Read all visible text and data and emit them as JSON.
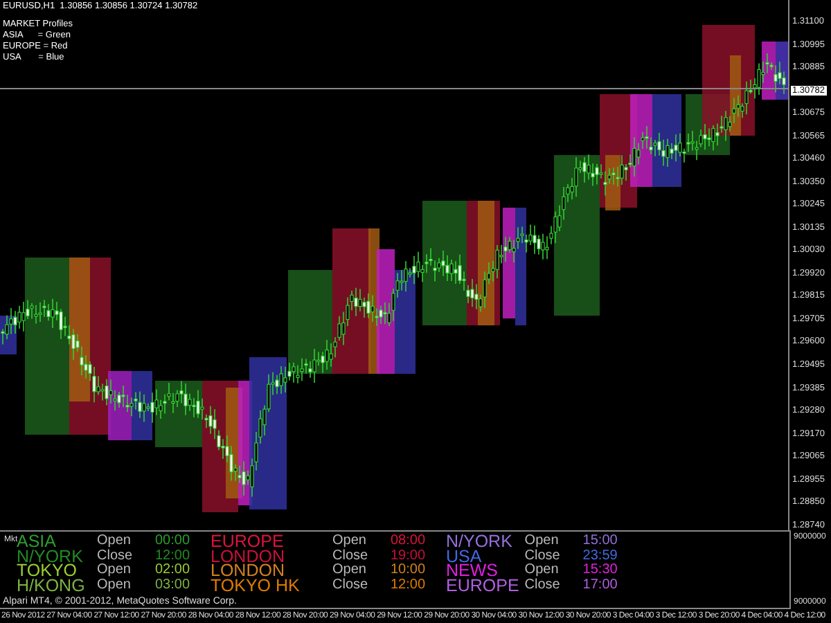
{
  "chart": {
    "title": "EURUSD,H1  1.30856 1.30856 1.30724 1.30782",
    "legend": [
      "MARKET Profiles",
      "ASIA      = Green",
      "EUROPE = Red",
      "USA       = Blue"
    ],
    "price_ticks": [
      {
        "label": "1.31100",
        "current": false
      },
      {
        "label": "1.30995",
        "current": false
      },
      {
        "label": "1.30885",
        "current": false
      },
      {
        "label": "1.30782",
        "current": true
      },
      {
        "label": "1.30675",
        "current": false
      }
    ],
    "price_ticks_lower": [
      "1.30565",
      "1.30460",
      "1.30350",
      "1.30245",
      "1.30135",
      "1.30030",
      "1.29920",
      "1.29815",
      "1.29705",
      "1.29600",
      "1.29495",
      "1.29385",
      "1.29280",
      "1.29170",
      "1.29065",
      "1.28955",
      "1.28850",
      "1.28740"
    ]
  },
  "indicator": {
    "label": "Mkt",
    "axis": [
      "9000000",
      "9000000"
    ],
    "sessions": [
      {
        "rows": [
          {
            "name": "ASIA",
            "status": "Open",
            "time": "00:00",
            "color": "#2e9e2e"
          },
          {
            "name": "N/YORK",
            "status": "Close",
            "time": "12:00",
            "color": "#228b22"
          },
          {
            "name": "TOKYO",
            "status": "Open",
            "time": "02:00",
            "color": "#9acd32"
          },
          {
            "name": "H/KONG",
            "status": "Open",
            "time": "03:00",
            "color": "#7cb342"
          }
        ]
      },
      {
        "rows": [
          {
            "name": "EUROPE",
            "status": "Open",
            "time": "08:00",
            "color": "#dc143c"
          },
          {
            "name": "LONDON",
            "status": "Close",
            "time": "19:00",
            "color": "#c8103a"
          },
          {
            "name": "LONDON",
            "status": "Open",
            "time": "10:00",
            "color": "#d2821e"
          },
          {
            "name": "TOKYO HK",
            "status": "Close",
            "time": "12:00",
            "color": "#e07b00"
          }
        ]
      },
      {
        "rows": [
          {
            "name": "N/YORK",
            "status": "Open",
            "time": "15:00",
            "color": "#9370db"
          },
          {
            "name": "USA",
            "status": "Close",
            "time": "23:59",
            "color": "#4169e1"
          },
          {
            "name": "NEWS",
            "status": "Open",
            "time": "15:30",
            "color": "#e020e0"
          },
          {
            "name": "EUROPE",
            "status": "Close",
            "time": "17:00",
            "color": "#b060e0"
          }
        ]
      }
    ],
    "footer": "Alpari MT4, © 2001-2012, MetaQuotes Software Corp."
  },
  "time_ticks": [
    "26 Nov 2012",
    "27 Nov 04:00",
    "27 Nov 12:00",
    "27 Nov 20:00",
    "28 Nov 04:00",
    "28 Nov 12:00",
    "28 Nov 20:00",
    "29 Nov 04:00",
    "29 Nov 12:00",
    "29 Nov 20:00",
    "30 Nov 04:00",
    "30 Nov 12:00",
    "30 Nov 20:00",
    "3 Dec 04:00",
    "3 Dec 12:00",
    "3 Dec 20:00",
    "4 Dec 04:00",
    "4 Dec 12:00"
  ]
}
